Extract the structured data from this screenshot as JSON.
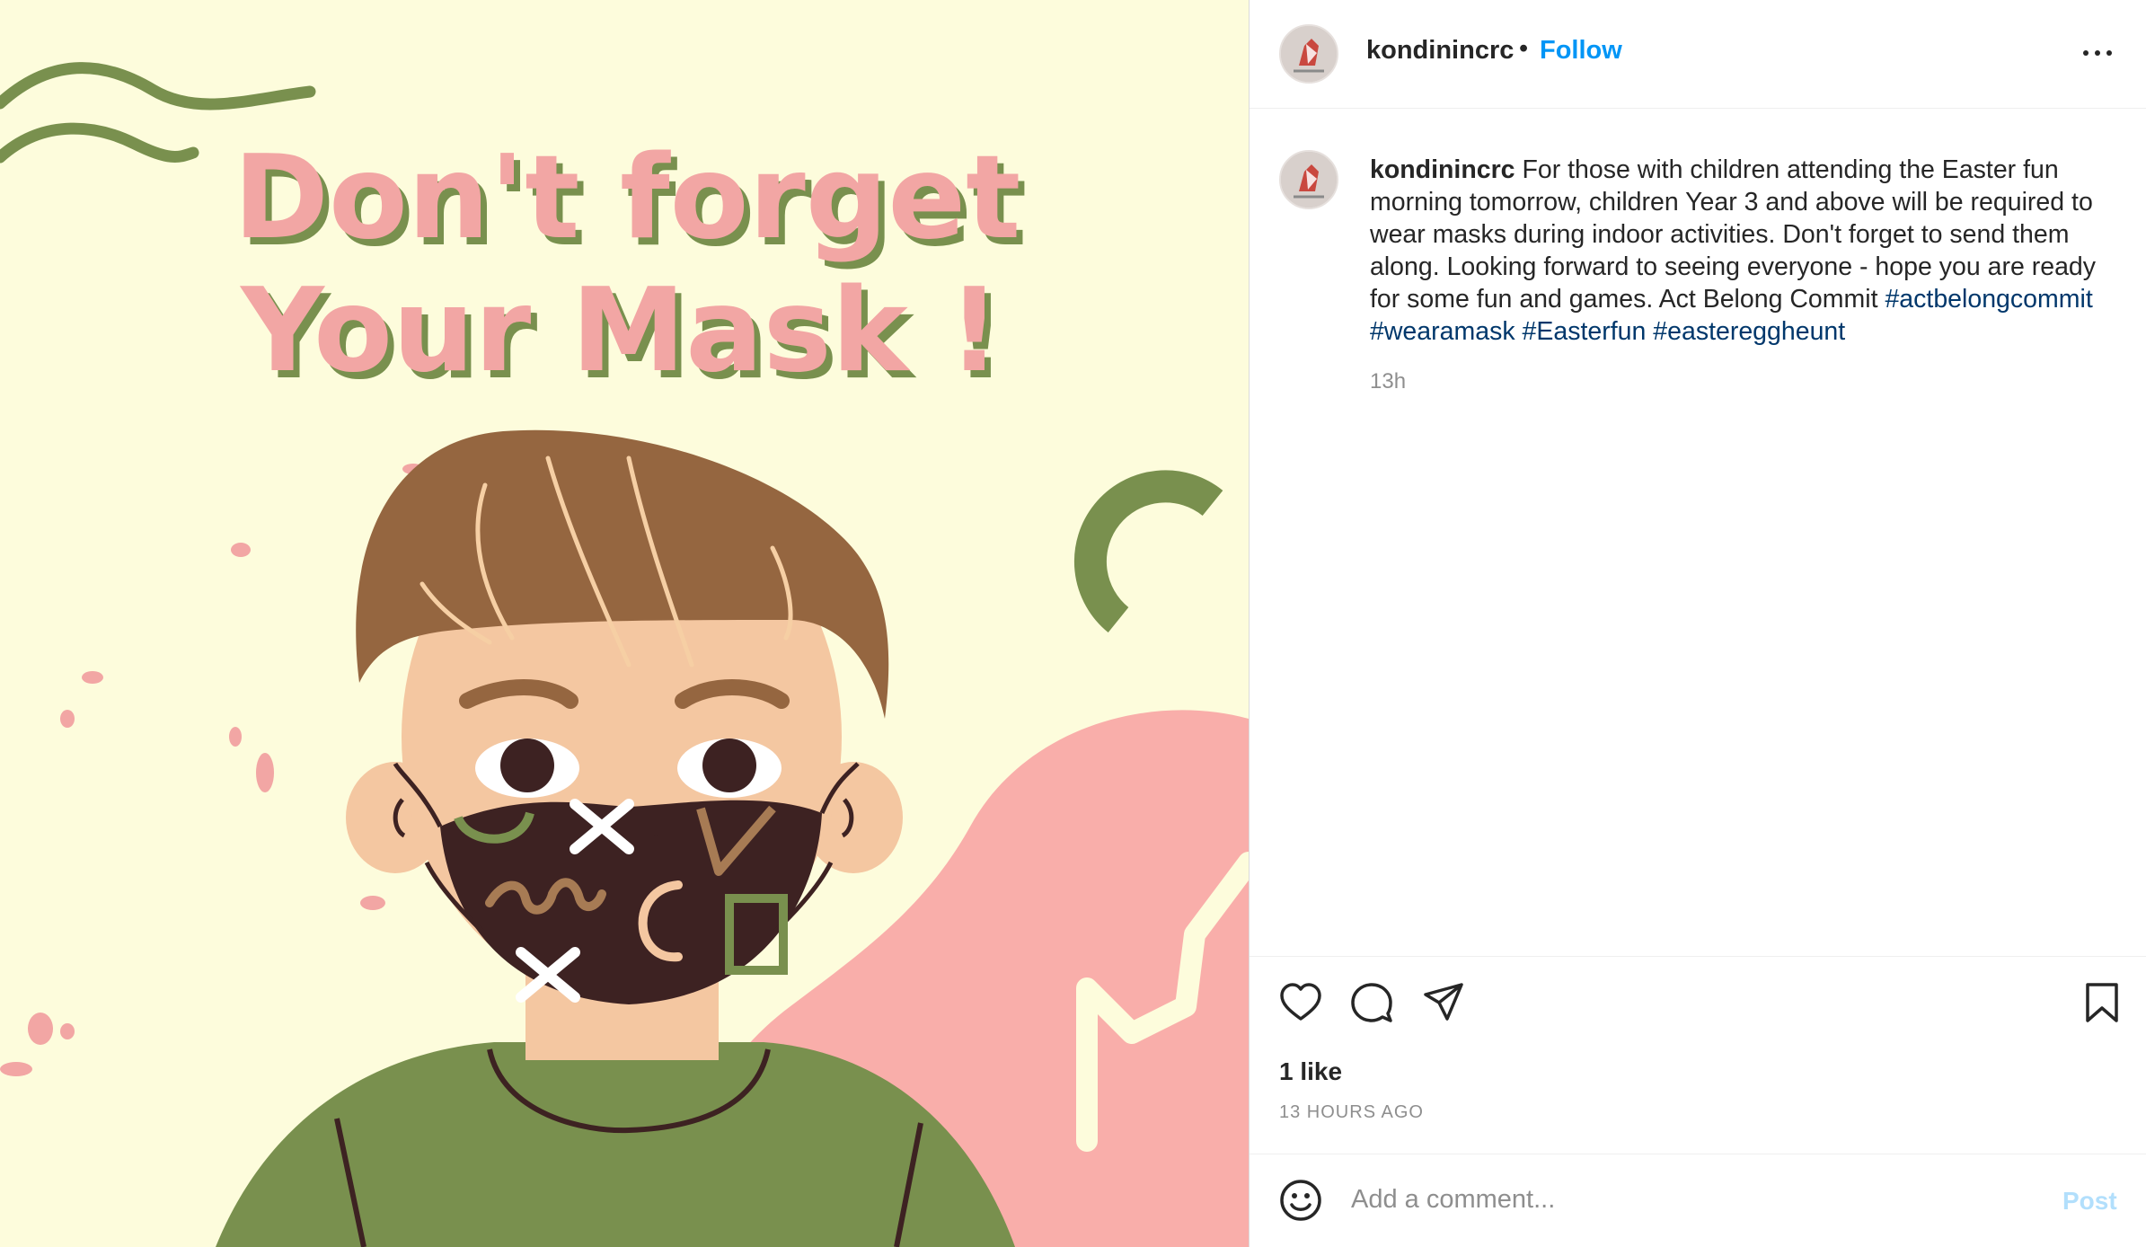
{
  "post": {
    "image_text_line1": "Don't forget",
    "image_text_line2": "Your Mask !"
  },
  "header": {
    "username": "kondinincrc",
    "separator": "•",
    "follow_label": "Follow"
  },
  "caption": {
    "username": "kondinincrc",
    "text": "For those with children attending the Easter fun morning tomorrow, children Year 3 and above will be required to wear masks during indoor activities. Don't forget to send them along. Looking forward to seeing everyone - hope you are ready for some fun and games. Act Belong Commit",
    "hashtags": [
      "#actbelongcommit",
      "#wearamask",
      "#Easterfun",
      "#eastereggheunt"
    ],
    "time": "13h"
  },
  "engagement": {
    "likes": "1 like",
    "posted_ago": "13 HOURS AGO"
  },
  "comment": {
    "placeholder": "Add a comment...",
    "post_label": "Post"
  },
  "icons": [
    "more-options-icon",
    "heart-icon",
    "comment-icon",
    "share-icon",
    "bookmark-icon",
    "emoji-icon"
  ],
  "colors": {
    "link_blue": "#0095f6",
    "hashtag": "#00376b",
    "muted": "#8e8e8e",
    "post_disabled": "#b2dffc",
    "image_bg": "#fdfcdc",
    "title_pink": "#f2a6a4",
    "title_shadow": "#79904e"
  }
}
